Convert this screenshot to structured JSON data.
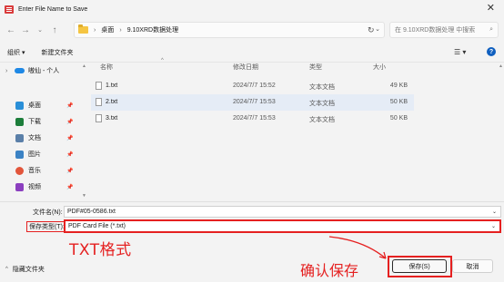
{
  "window": {
    "title": "Enter File Name to Save",
    "close_glyph": "✕"
  },
  "nav": {
    "breadcrumb": [
      "桌面",
      "9.10XRD数据处理"
    ],
    "search_placeholder": "在 9.10XRD数据处理 中搜索"
  },
  "toolbar": {
    "organize": "组织 ▾",
    "new_folder": "新建文件夹"
  },
  "sidebar": {
    "items": [
      {
        "label": "嗷仙 - 个人",
        "icon": "cloud-icon",
        "pinned": false
      },
      {
        "label": "桌面",
        "icon": "desktop-icon",
        "pinned": true
      },
      {
        "label": "下载",
        "icon": "download-icon",
        "pinned": true
      },
      {
        "label": "文档",
        "icon": "document-icon",
        "pinned": true
      },
      {
        "label": "图片",
        "icon": "picture-icon",
        "pinned": true
      },
      {
        "label": "音乐",
        "icon": "music-icon",
        "pinned": true
      },
      {
        "label": "视频",
        "icon": "video-icon",
        "pinned": true
      }
    ]
  },
  "columns": {
    "name": "名称",
    "date": "修改日期",
    "type": "类型",
    "size": "大小"
  },
  "files": [
    {
      "name": "1.txt",
      "date": "2024/7/7 15:52",
      "type": "文本文档",
      "size": "49 KB",
      "selected": false
    },
    {
      "name": "2.txt",
      "date": "2024/7/7 15:53",
      "type": "文本文档",
      "size": "50 KB",
      "selected": true
    },
    {
      "name": "3.txt",
      "date": "2024/7/7 15:53",
      "type": "文本文档",
      "size": "50 KB",
      "selected": false
    }
  ],
  "form": {
    "filename_label": "文件名(N):",
    "filename_value": "PDF#05-0586.txt",
    "type_label": "保存类型(T):",
    "type_value": "PDF Card File (*.txt)"
  },
  "footer": {
    "hide_folders": "隐藏文件夹",
    "save": "保存(S)",
    "cancel": "取消"
  },
  "annotations": {
    "format_note": "TXT格式",
    "save_note": "确认保存",
    "color": "#e52020"
  }
}
